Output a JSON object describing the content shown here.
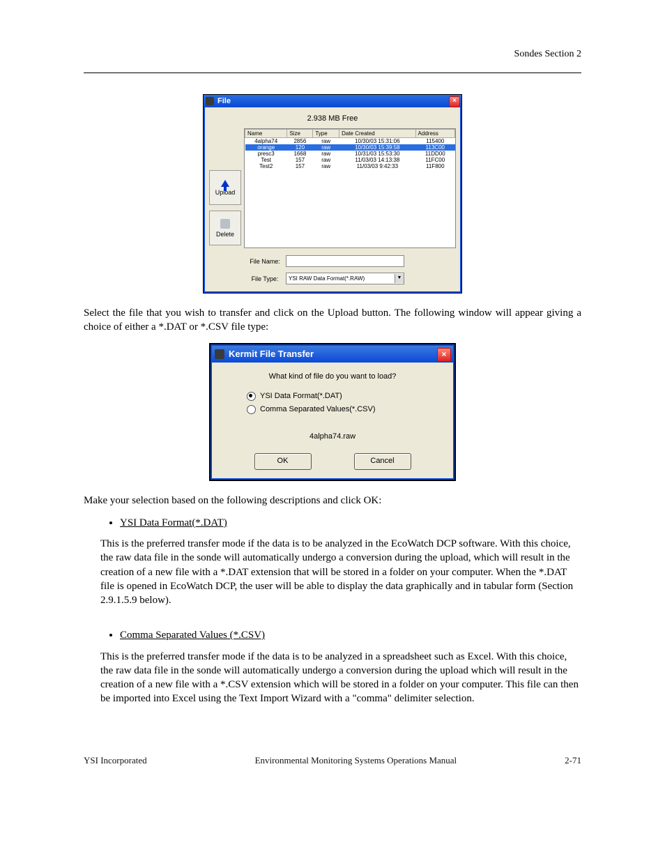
{
  "header": {
    "right": "Sondes                     Section 2"
  },
  "dialog1": {
    "title": "File",
    "free_text": "2.938  MB Free",
    "columns": [
      "Name",
      "Size",
      "Type",
      "Date Created",
      "Address"
    ],
    "rows": [
      {
        "name": "4alpha74",
        "size": "2856",
        "type": "raw",
        "date": "10/30/03 15:31:06",
        "addr": "115400",
        "selected": false
      },
      {
        "name": "orange",
        "size": "120",
        "type": "raw",
        "date": "10/30/03 15:39:58",
        "addr": "113C00",
        "selected": true
      },
      {
        "name": "presc3",
        "size": "1668",
        "type": "raw",
        "date": "10/31/03 15:53:30",
        "addr": "11DD00",
        "selected": false
      },
      {
        "name": "Test",
        "size": "157",
        "type": "raw",
        "date": "11/03/03 14:13:38",
        "addr": "11FC00",
        "selected": false
      },
      {
        "name": "Test2",
        "size": "157",
        "type": "raw",
        "date": "11/03/03 9:42:33",
        "addr": "11F800",
        "selected": false
      }
    ],
    "upload_label": "Upload",
    "delete_label": "Delete",
    "fn_label": "File Name:",
    "fn_value": "",
    "ft_label": "File Type:",
    "ft_value": "YSI RAW Data Format(*.RAW)"
  },
  "para1": "Select the file that you wish to transfer and click on the Upload button.   The following window will appear giving a choice of either a *.DAT or *.CSV file type:",
  "dialog2": {
    "title": "Kermit File Transfer",
    "question": "What kind of file do you want to load?",
    "opt1": "YSI Data Format(*.DAT)",
    "opt2": "Comma Separated Values(*.CSV)",
    "file_shown": "4alpha74.raw",
    "ok": "OK",
    "cancel": "Cancel"
  },
  "para2": "Make your selection based on the following descriptions and click OK:",
  "bullet1": {
    "head": "YSI Data Format(*.DAT)",
    "body": "This is the preferred transfer mode if the data is to be analyzed in the EcoWatch DCP software.  With this choice, the raw data file in the sonde will automatically undergo a conversion during the upload, which will result in the creation of a new file with a *.DAT extension that will be stored in a folder on your computer.   When the *.DAT file is opened in EcoWatch DCP, the user will be able to display the data graphically and in tabular form (Section 2.9.1.5.9 below)."
  },
  "bullet2": {
    "head": "Comma Separated Values (*.CSV)",
    "body": "This is the preferred transfer mode if the data is to be analyzed in a spreadsheet such as Excel.   With this choice, the raw data file in the sonde will automatically undergo a conversion during the upload which will result in the creation of a new file with a *.CSV extension which will be stored in a folder on your computer.   This file can then be imported into Excel using the Text Import Wizard with a \"comma\" delimiter selection."
  },
  "footer": {
    "left": "YSI Incorporated",
    "center": "Environmental Monitoring Systems Operations Manual",
    "right": "2-71"
  }
}
